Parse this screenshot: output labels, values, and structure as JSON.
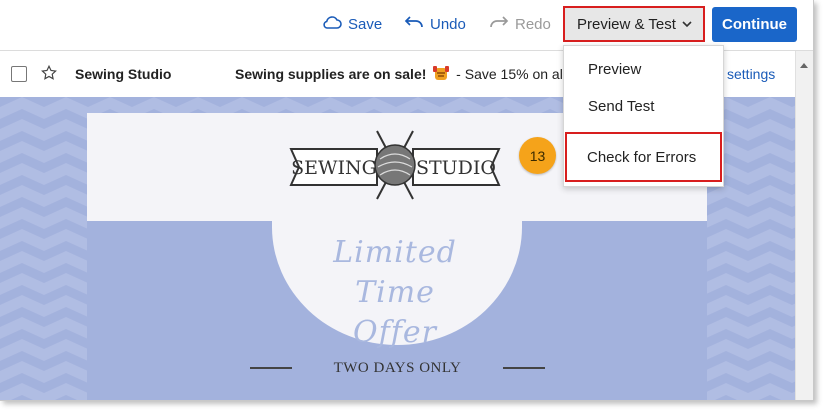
{
  "toolbar": {
    "save_label": "Save",
    "undo_label": "Undo",
    "redo_label": "Redo",
    "preview_test_label": "Preview & Test",
    "continue_label": "Continue"
  },
  "email_row": {
    "sender": "Sewing Studio",
    "subject_bold": "Sewing supplies are on sale!",
    "subject_rest": " - Save 15% on al",
    "settings_link": "settings"
  },
  "email_body": {
    "logo_left": "SEWING",
    "logo_right": "STUDIO",
    "headline_line1": "Limited Time",
    "headline_line2": "Offer",
    "banner": "TWO DAYS ONLY"
  },
  "dropdown": {
    "items": [
      "Preview",
      "Send Test",
      "Check for Errors"
    ]
  },
  "step_badge": "13",
  "icons": [
    "cloud-icon",
    "undo-arrow-icon",
    "redo-arrow-icon",
    "chevron-down-icon",
    "star-icon",
    "emoji-icon",
    "scroll-up-arrow-icon",
    "yarn-ball-icon"
  ],
  "colors": {
    "accent_blue": "#1a66c9",
    "highlight_red": "#d81e1e",
    "badge_orange": "#f5a31a",
    "email_bg_blue": "#a3b2dd"
  }
}
